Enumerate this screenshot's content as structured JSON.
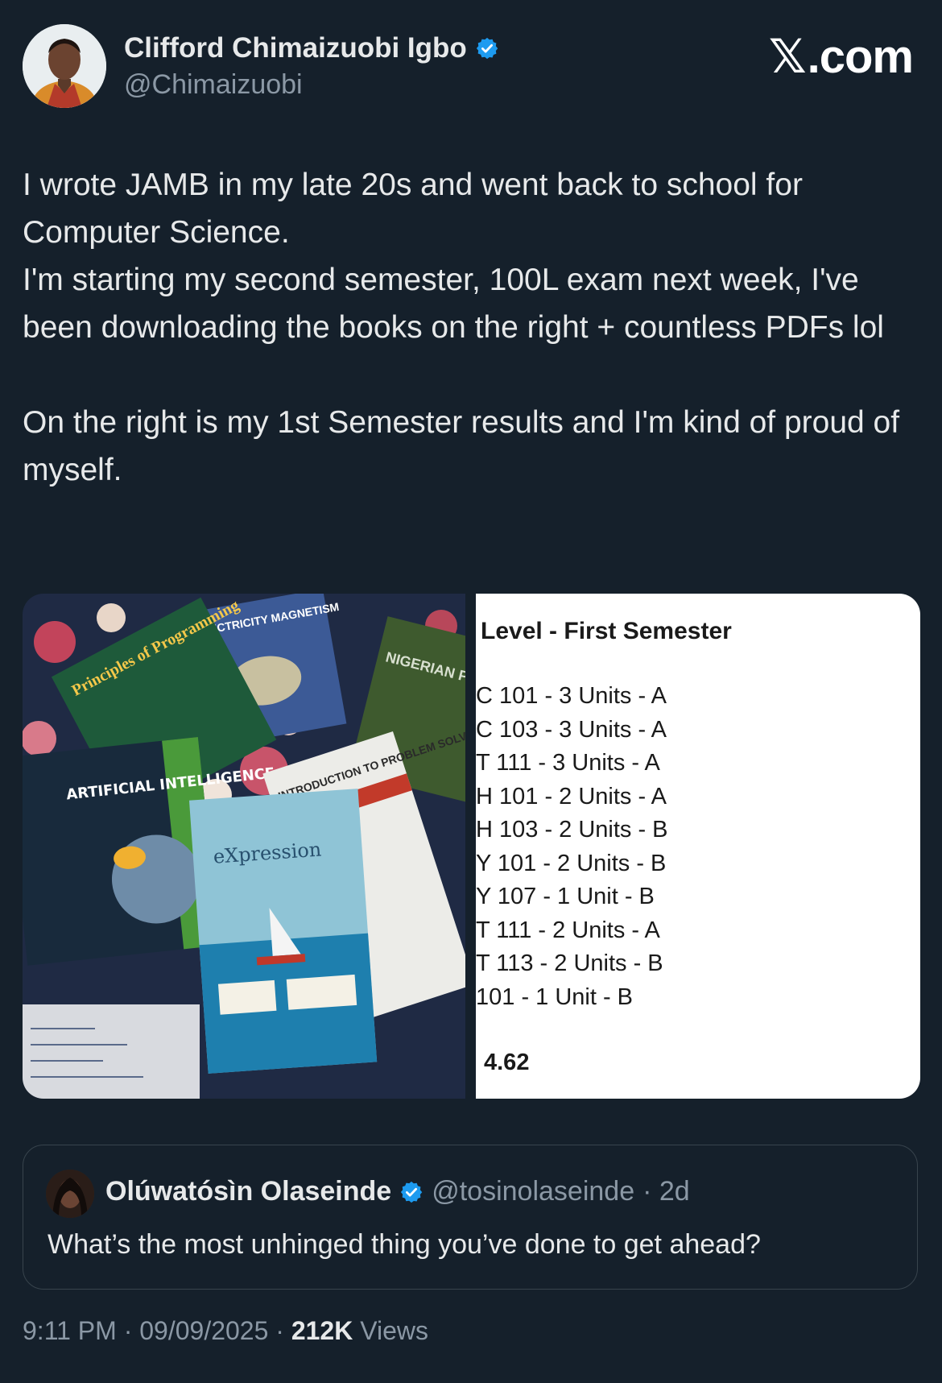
{
  "author": {
    "name": "Clifford Chimaizuobi Igbo",
    "handle": "@Chimaizuobi",
    "verified_icon": "verified-badge-icon",
    "verified_color": "#1d9bf0"
  },
  "brand": {
    "x_glyph": "𝕏",
    "domain": ".com"
  },
  "tweet": {
    "text": "I wrote JAMB in my late 20s and went back to school for Computer Science.\nI'm starting my second semester, 100L exam next week, I've been downloading the books on the right + countless PDFs lol\n\nOn the right is my 1st Semester results and I'm kind of proud of myself."
  },
  "media": {
    "left": {
      "books": [
        "Principles of Programming",
        "ELECTRICITY MAGNETISM",
        "NIGERIAN PEOPLES CULTURE",
        "ARTIFICIAL INTELLIGENCE",
        "INTRODUCTION TO PROBLEM SOLVING",
        "eXpression"
      ]
    },
    "right": {
      "title": "Level - First Semester",
      "results": [
        "C 101 - 3 Units - A",
        "C 103 - 3 Units - A",
        "T 111 - 3 Units - A",
        "H 101 - 2 Units - A",
        "H 103 - 2 Units - B",
        "Y 101 - 2 Units - B",
        "Y 107 - 1 Unit - B",
        "T 111 - 2 Units - A",
        "T 113 - 2 Units - B",
        "101 - 1 Unit - B"
      ],
      "gpa": "4.62"
    }
  },
  "quote": {
    "name": "Olúwatósìn Olaseinde",
    "handle": "@tosinolaseinde",
    "time": "· 2d",
    "text": "What’s the most unhinged thing you’ve done to get ahead?"
  },
  "meta": {
    "time": "9:11 PM",
    "sep1": " · ",
    "date": "09/09/2025",
    "sep2": " · ",
    "views_count": "212K",
    "views_label": " Views"
  }
}
